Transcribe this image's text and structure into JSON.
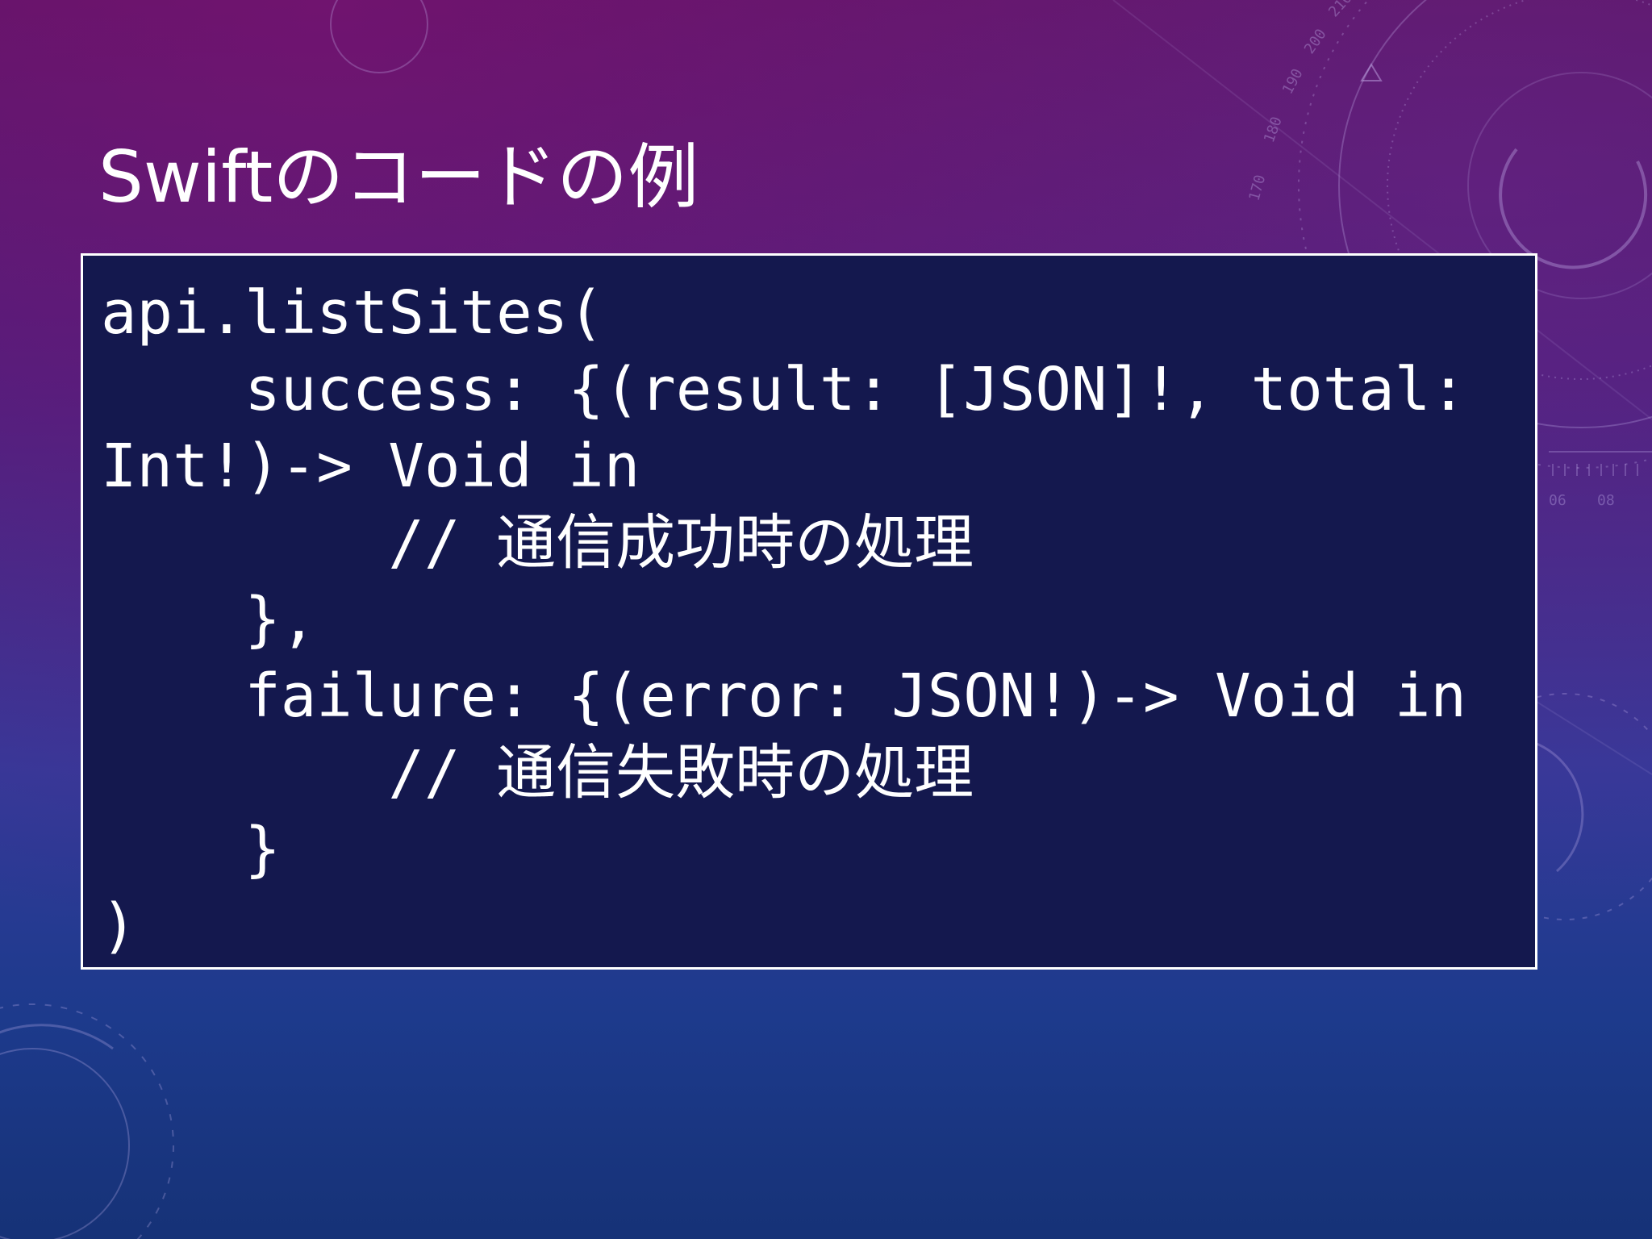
{
  "slide": {
    "title": "Swiftのコードの例"
  },
  "code": {
    "lines": [
      "api.listSites(",
      "    success: {(result: [JSON]!, total:",
      "Int!)-> Void in",
      "        // 通信成功時の処理",
      "    },",
      "    failure: {(error: JSON!)-> Void in",
      "        // 通信失敗時の処理",
      "    }",
      ")"
    ]
  },
  "decoration": {
    "dial_numbers": [
      "170",
      "180",
      "190",
      "200",
      "210",
      "06",
      "08"
    ]
  },
  "colors": {
    "code_background": "#14184e",
    "code_border": "#ffffff",
    "text": "#ffffff",
    "background_top": "#5a1464",
    "background_bottom": "#163277"
  }
}
